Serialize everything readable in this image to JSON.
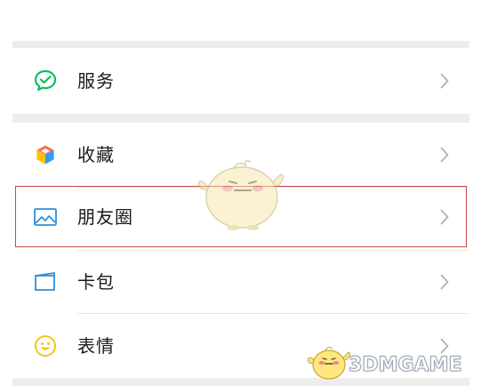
{
  "menu": {
    "items": [
      {
        "label": "服务",
        "icon": "wechat-pay-icon",
        "chevron": "chevron-right-icon"
      },
      {
        "label": "收藏",
        "icon": "favorites-cube-icon",
        "chevron": "chevron-right-icon"
      },
      {
        "label": "朋友圈",
        "icon": "moments-image-icon",
        "chevron": "chevron-right-icon"
      },
      {
        "label": "卡包",
        "icon": "card-wallet-icon",
        "chevron": "chevron-right-icon"
      },
      {
        "label": "表情",
        "icon": "sticker-smile-icon",
        "chevron": "chevron-right-icon"
      }
    ]
  },
  "watermark": {
    "text": "3DMGAME"
  },
  "colors": {
    "page_bg": "#ffffff",
    "gap_bg": "#ededed",
    "highlight_border": "#c9484a",
    "wechat_green": "#07c160",
    "moments_blue": "#2f8fd8",
    "card_blue": "#2b8fe0",
    "sticker_yellow": "#f5c518",
    "chevron_gray": "#b2b2b2"
  }
}
